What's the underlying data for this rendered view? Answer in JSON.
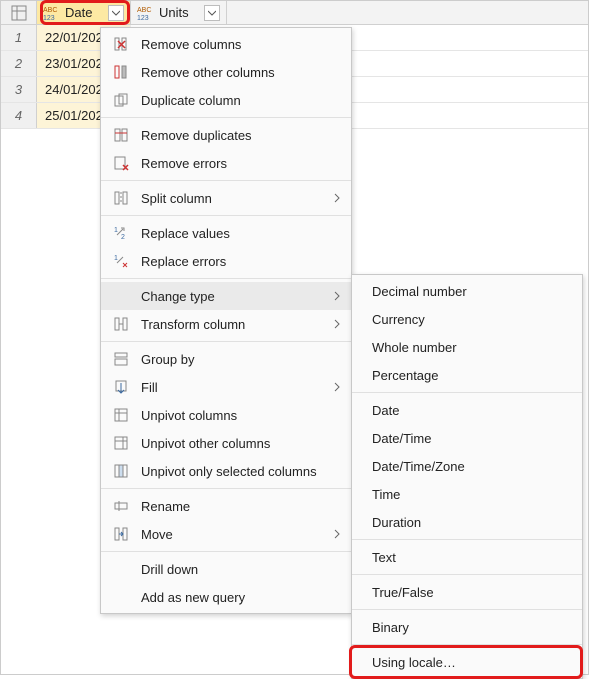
{
  "columns": [
    {
      "name": "Date",
      "type_icon": "abc-123-icon",
      "selected": true
    },
    {
      "name": "Units",
      "type_icon": "abc-123-icon",
      "selected": false
    }
  ],
  "rows": [
    {
      "num": "1",
      "date": "22/01/202"
    },
    {
      "num": "2",
      "date": "23/01/202"
    },
    {
      "num": "3",
      "date": "24/01/202"
    },
    {
      "num": "4",
      "date": "25/01/202"
    }
  ],
  "menu": {
    "remove_columns": "Remove columns",
    "remove_other_columns": "Remove other columns",
    "duplicate_column": "Duplicate column",
    "remove_duplicates": "Remove duplicates",
    "remove_errors": "Remove errors",
    "split_column": "Split column",
    "replace_values": "Replace values",
    "replace_errors": "Replace errors",
    "change_type": "Change type",
    "transform_column": "Transform column",
    "group_by": "Group by",
    "fill": "Fill",
    "unpivot_columns": "Unpivot columns",
    "unpivot_other": "Unpivot other columns",
    "unpivot_selected": "Unpivot only selected columns",
    "rename": "Rename",
    "move": "Move",
    "drill_down": "Drill down",
    "add_as_new_query": "Add as new query"
  },
  "submenu": {
    "decimal": "Decimal number",
    "currency": "Currency",
    "whole": "Whole number",
    "percentage": "Percentage",
    "date": "Date",
    "datetime": "Date/Time",
    "datetimezone": "Date/Time/Zone",
    "time": "Time",
    "duration": "Duration",
    "text": "Text",
    "truefalse": "True/False",
    "binary": "Binary",
    "using_locale": "Using locale…"
  },
  "colors": {
    "selected_header": "#fde9a3",
    "highlight_border": "#e21b1b"
  }
}
